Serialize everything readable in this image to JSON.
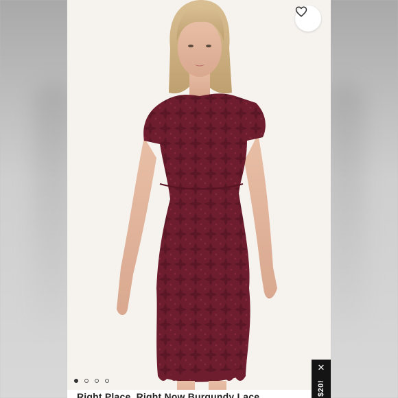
{
  "listing": {
    "title": "Right Place, Right Now Burgundy Lace",
    "price_label": "$20!",
    "like_icon": "heart-outline-icon",
    "close_icon": "close-icon"
  },
  "gallery": {
    "image_count": 4,
    "active_index": 0
  },
  "colors": {
    "dress": "#6e1d2e",
    "background": "#f6f3ef",
    "price_tag": "#141414"
  }
}
